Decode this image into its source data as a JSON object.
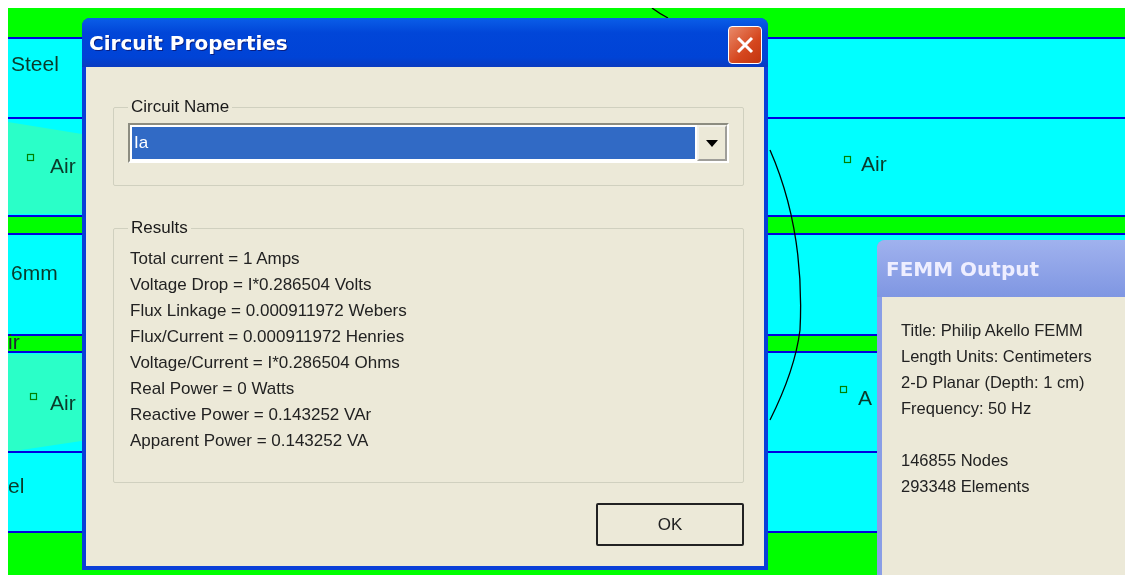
{
  "canvas": {
    "labels": [
      {
        "text": "Steel"
      },
      {
        "text": "Air"
      },
      {
        "text": "6mm"
      },
      {
        "text": "ir"
      },
      {
        "text": "Air"
      },
      {
        "text": "el"
      },
      {
        "text": "Air"
      },
      {
        "text": "A"
      }
    ]
  },
  "dialog": {
    "title": "Circuit Properties",
    "circuit_name": {
      "legend": "Circuit Name",
      "value": "Ia",
      "selected": true
    },
    "results": {
      "legend": "Results",
      "lines": [
        "Total current = 1 Amps",
        "Voltage Drop = I*0.286504 Volts",
        "Flux Linkage = 0.000911972 Webers",
        "Flux/Current = 0.000911972 Henries",
        "Voltage/Current = I*0.286504 Ohms",
        "Real Power = 0 Watts",
        "Reactive Power = 0.143252 VAr",
        "Apparent Power = 0.143252 VA"
      ]
    },
    "buttons": [
      "OK"
    ]
  },
  "output_window": {
    "title": "FEMM Output",
    "sections": [
      [
        "Title: Philip Akello FEMM",
        "Length Units: Centimeters",
        "2-D Planar (Depth: 1 cm)",
        "Frequency: 50 Hz"
      ],
      [
        "146855 Nodes",
        "293348 Elements"
      ]
    ]
  }
}
